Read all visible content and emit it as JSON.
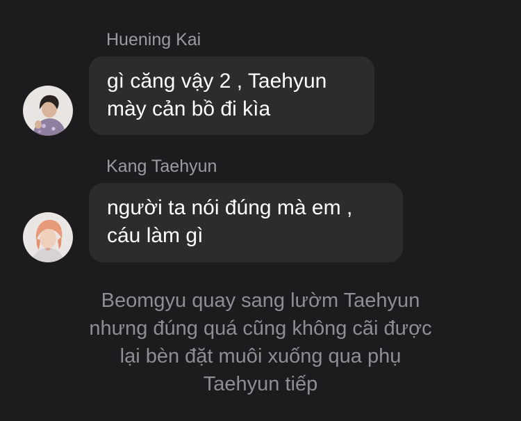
{
  "messages": [
    {
      "sender": "Huening Kai",
      "text": "gì căng vậy 2 , Taehyun\nmày cản bồ đi kìa",
      "avatar_icon": "person-avatar-icon"
    },
    {
      "sender": "Kang Taehyun",
      "text": "người ta nói đúng mà em ,\ncáu làm gì",
      "avatar_icon": "person-avatar-icon"
    }
  ],
  "narration": "Beomgyu quay sang lườm Taehyun\nnhưng đúng quá cũng không cãi được\nlại bèn đặt muôi xuống qua phụ\nTaehyun tiếp",
  "colors": {
    "background": "#1c1c1e",
    "bubble": "#2c2c2e",
    "sender_name": "#9b9ba0",
    "message_text": "#ffffff",
    "narration_text": "#8e8e93"
  }
}
